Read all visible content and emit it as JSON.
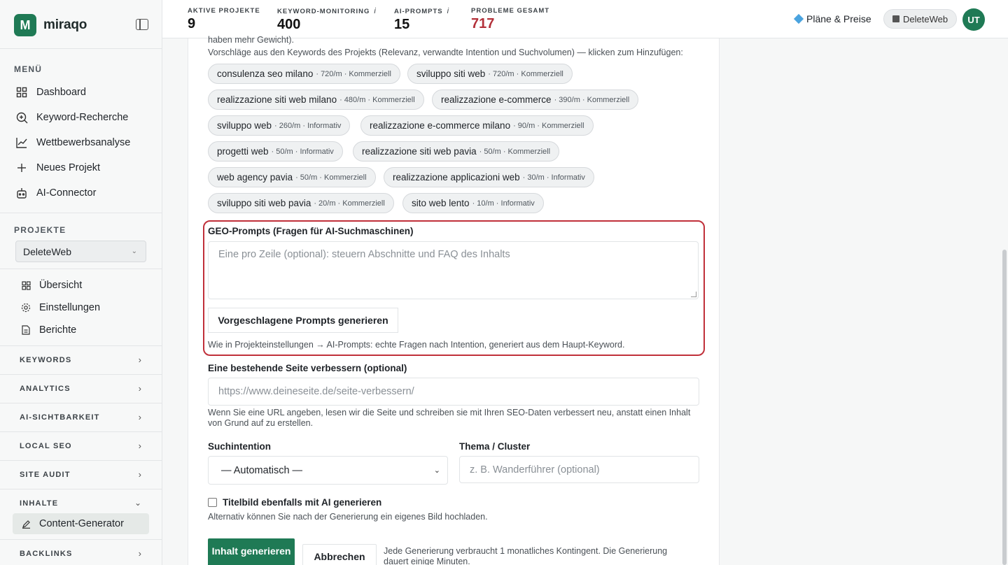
{
  "brand": {
    "name": "miraqo",
    "logo_letter": "M"
  },
  "sidebar": {
    "menu_heading": "MENÜ",
    "menu": [
      {
        "label": "Dashboard",
        "icon": "grid-icon"
      },
      {
        "label": "Keyword-Recherche",
        "icon": "search-icon"
      },
      {
        "label": "Wettbewerbsanalyse",
        "icon": "chart-line-icon"
      },
      {
        "label": "Neues Projekt",
        "icon": "plus-icon"
      },
      {
        "label": "AI-Connector",
        "icon": "robot-icon"
      }
    ],
    "projects_heading": "PROJEKTE",
    "project_selected": "DeleteWeb",
    "project_links": [
      {
        "label": "Übersicht",
        "icon": "grid-small-icon"
      },
      {
        "label": "Einstellungen",
        "icon": "gear-icon"
      },
      {
        "label": "Berichte",
        "icon": "document-icon"
      }
    ],
    "groups": [
      {
        "label": "KEYWORDS"
      },
      {
        "label": "ANALYTICS"
      },
      {
        "label": "AI-SICHTBARKEIT"
      },
      {
        "label": "LOCAL SEO"
      },
      {
        "label": "SITE AUDIT"
      },
      {
        "label": "INHALTE"
      },
      {
        "label": "BACKLINKS"
      }
    ],
    "active_item": "Content-Generator"
  },
  "topbar": {
    "stats": [
      {
        "label": "AKTIVE PROJEKTE",
        "value": "9",
        "info": ""
      },
      {
        "label": "KEYWORD-MONITORING",
        "value": "400",
        "info": "i"
      },
      {
        "label": "AI-PROMPTS",
        "value": "15",
        "info": "i"
      },
      {
        "label": "PROBLEME GESAMT",
        "value": "717",
        "info": ""
      }
    ],
    "plans_label": "Pläne & Preise",
    "workspace_label": "DeleteWeb",
    "avatar_initials": "UT"
  },
  "form": {
    "cut_text": "haben mehr Gewicht).",
    "suggestions_hint": "Vorschläge aus den Keywords des Projekts (Relevanz, verwandte Intention und Suchvolumen) — klicken zum Hinzufügen:",
    "suggestions": [
      {
        "kw": "consulenza seo milano",
        "meta": "· 720/m · Kommerziell"
      },
      {
        "kw": "sviluppo siti web",
        "meta": "· 720/m · Kommerziell"
      },
      {
        "kw": "realizzazione siti web milano",
        "meta": "· 480/m · Kommerziell"
      },
      {
        "kw": "realizzazione e-commerce",
        "meta": "· 390/m · Kommerziell"
      },
      {
        "kw": "sviluppo web",
        "meta": "· 260/m · Informativ"
      },
      {
        "kw": "realizzazione e-commerce milano",
        "meta": "· 90/m · Kommerziell"
      },
      {
        "kw": "progetti web",
        "meta": "· 50/m · Informativ"
      },
      {
        "kw": "realizzazione siti web pavia",
        "meta": "· 50/m · Kommerziell"
      },
      {
        "kw": "web agency pavia",
        "meta": "· 50/m · Kommerziell"
      },
      {
        "kw": "realizzazione applicazioni web",
        "meta": "· 30/m · Informativ"
      },
      {
        "kw": "sviluppo siti web pavia",
        "meta": "· 20/m · Kommerziell"
      },
      {
        "kw": "sito web lento",
        "meta": "· 10/m · Informativ"
      }
    ],
    "geo_label": "GEO-Prompts (Fragen für AI-Suchmaschinen)",
    "geo_placeholder": "Eine pro Zeile (optional): steuern Abschnitte und FAQ des Inhalts",
    "geo_button": "Vorgeschlagene Prompts generieren",
    "geo_help": "Wie in Projekteinstellungen → AI-Prompts: echte Fragen nach Intention, generiert aus dem Haupt-Keyword.",
    "improve_label": "Eine bestehende Seite verbessern (optional)",
    "improve_placeholder": "https://www.deineseite.de/seite-verbessern/",
    "improve_help": "Wenn Sie eine URL angeben, lesen wir die Seite und schreiben sie mit Ihren SEO-Daten verbessert neu, anstatt einen Inhalt von Grund auf zu erstellen.",
    "intent_label": "Suchintention",
    "intent_value": "— Automatisch —",
    "topic_label": "Thema / Cluster",
    "topic_placeholder": "z. B. Wanderführer (optional)",
    "image_checkbox_label": "Titelbild ebenfalls mit AI generieren",
    "image_help": "Alternativ können Sie nach der Generierung ein eigenes Bild hochladen.",
    "submit_label": "Inhalt generieren",
    "cancel_label": "Abbrechen",
    "quota_note": "Jede Generierung verbraucht 1 monatliches Kontingent. Die Generierung dauert einige Minuten."
  },
  "colors": {
    "brand": "#1f7a55",
    "alert": "#b3313a",
    "highlight": "#c0303a"
  }
}
